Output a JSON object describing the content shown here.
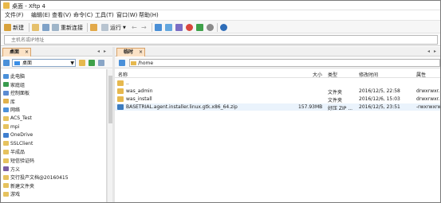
{
  "window": {
    "title": "桌面 - Xftp 4"
  },
  "menu": [
    "文件(F)",
    "编辑(E)",
    "查看(V)",
    "命令(C)",
    "工具(T)",
    "窗口(W)",
    "帮助(H)"
  ],
  "toolbar": {
    "new_label": "新建",
    "reconnect_label": "重新连接",
    "run_label": "运行"
  },
  "address": {
    "placeholder": "主机名或IP地址"
  },
  "left": {
    "tab": "桌面",
    "tab_close": "×",
    "path": "桌面",
    "tree": [
      {
        "label": "此电脑",
        "color": "#4a90d9"
      },
      {
        "label": "家庭组",
        "color": "#3a9b4e"
      },
      {
        "label": "控制面板",
        "color": "#5b8bd1"
      },
      {
        "label": "库",
        "color": "#e1b14b"
      },
      {
        "label": "网络",
        "color": "#4a90d9"
      },
      {
        "label": "ACS_Test",
        "color": "#e6c25e"
      },
      {
        "label": "mpi",
        "color": "#e6c25e"
      },
      {
        "label": "OneDrive",
        "color": "#3f7fcf"
      },
      {
        "label": "SSLClient",
        "color": "#e6c25e"
      },
      {
        "label": "半成品",
        "color": "#e6c25e"
      },
      {
        "label": "短信验证码",
        "color": "#e6c25e"
      },
      {
        "label": "方义",
        "color": "#7a5da3"
      },
      {
        "label": "交行投产文档@20160415",
        "color": "#e6c25e"
      },
      {
        "label": "新建文件夹",
        "color": "#e6c25e"
      },
      {
        "label": "游戏",
        "color": "#e6c25e"
      }
    ]
  },
  "right": {
    "tab": "临时",
    "tab_close": "×",
    "path": "/home",
    "columns": {
      "name": "名称",
      "size": "大小",
      "type": "类型",
      "modified": "修改时间",
      "attr": "属性"
    },
    "files": [
      {
        "name": "..",
        "size": "",
        "type": "",
        "modified": "",
        "attr": "",
        "kind": "folder"
      },
      {
        "name": "was_admin",
        "size": "",
        "type": "文件夹",
        "modified": "2016/12/5, 22:58",
        "attr": "drwxrwxr...",
        "kind": "folder"
      },
      {
        "name": "was_install",
        "size": "",
        "type": "文件夹",
        "modified": "2016/12/6, 15:03",
        "attr": "drwxrwxr...",
        "kind": "folder"
      },
      {
        "name": "BASETRIAL.agent.installer.linux.gtk.x86_64.zip",
        "size": "157.93MB",
        "type": "好压 ZIP ...",
        "modified": "2016/12/5, 23:51",
        "attr": "-rwxrwxrw...",
        "kind": "zip"
      }
    ]
  },
  "colors": {
    "tab_active": "#fbe2c6",
    "tab_border": "#d8a36a",
    "folder": "#e6b84e",
    "selection": "#eaf3fc"
  }
}
